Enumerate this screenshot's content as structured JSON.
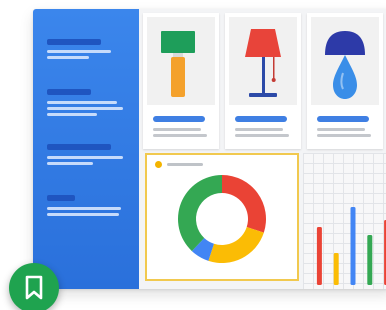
{
  "sidebar": {
    "groups": [
      {
        "lines": 2
      },
      {
        "lines": 3
      },
      {
        "lines": 2
      },
      {
        "lines": 2
      }
    ]
  },
  "product_cards": [
    {
      "icon": "table-lamp-icon",
      "shade_color": "#1e9e5a",
      "base_color": "#f4a12c"
    },
    {
      "icon": "table-lamp-icon",
      "shade_color": "#e8443a",
      "base_color": "#2c4aa8"
    },
    {
      "icon": "mushroom-lamp-icon",
      "shade_color": "#2d3aa8",
      "base_color": "#3a8ee8"
    }
  ],
  "chart_data": [
    {
      "type": "pie",
      "donut": true,
      "slices": [
        {
          "color": "#ea4335",
          "value": 30
        },
        {
          "color": "#fbbc05",
          "value": 25
        },
        {
          "color": "#4285f4",
          "value": 7
        },
        {
          "color": "#34a853",
          "value": 38
        }
      ]
    },
    {
      "type": "bar",
      "grid": true,
      "values": [
        58,
        32,
        78,
        50,
        65
      ],
      "colors": [
        "#ea4335",
        "#fbbc05",
        "#4285f4",
        "#34a853",
        "#ea4335"
      ],
      "ylim": [
        0,
        100
      ]
    }
  ],
  "fab": {
    "icon": "bookmark-icon",
    "color": "#1fa34f"
  }
}
